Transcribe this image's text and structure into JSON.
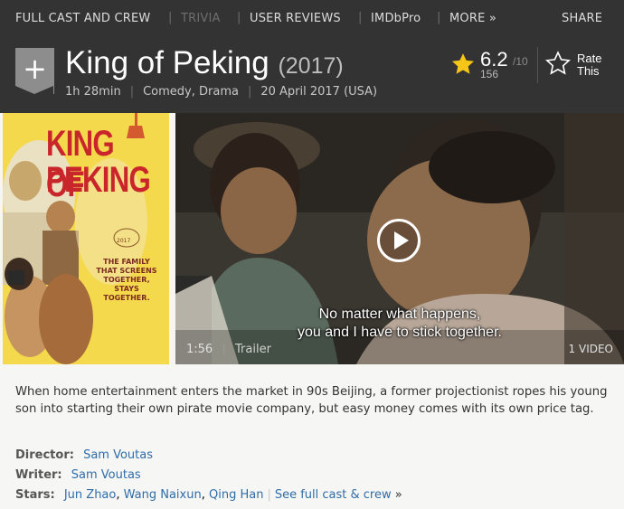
{
  "nav": {
    "items": [
      "FULL CAST AND CREW",
      "TRIVIA",
      "USER REVIEWS",
      "IMDbPro",
      "MORE »"
    ],
    "share": "SHARE"
  },
  "title": {
    "name": "King of Peking",
    "year": "(2017)",
    "add_icon": "plus-icon"
  },
  "subtext": {
    "runtime": "1h 28min",
    "genres": "Comedy, Drama",
    "release": "20 April 2017 (USA)"
  },
  "rating": {
    "value": "6.2",
    "max": "/10",
    "count": "156",
    "rate_label": "Rate This",
    "star_color": "#f5c518",
    "star_icon": "star-icon",
    "rate_icon": "outline-star-icon"
  },
  "poster": {
    "title_line1": "KING OF",
    "title_line2": "PEKING",
    "tagline": "THE FAMILY THAT SCREENS TOGETHER, STAYS TOGETHER.",
    "laurel_year": "2017"
  },
  "video": {
    "subtitle_line1": "No matter what happens,",
    "subtitle_line2": "you and I have to stick together.",
    "duration": "1:56",
    "type": "Trailer",
    "count": "1 VIDEO",
    "play_icon": "play-icon"
  },
  "plot": "When home entertainment enters the market in 90s Beijing, a former projectionist ropes his young son into starting their own pirate movie company, but easy money comes with its own price tag.",
  "credits": {
    "director_label": "Director:",
    "director": "Sam Voutas",
    "writer_label": "Writer:",
    "writer": "Sam Voutas",
    "stars_label": "Stars:",
    "stars": [
      "Jun Zhao",
      "Wang Naixun",
      "Qing Han"
    ],
    "see_all": "See full cast & crew",
    "see_all_arrow": "»"
  }
}
